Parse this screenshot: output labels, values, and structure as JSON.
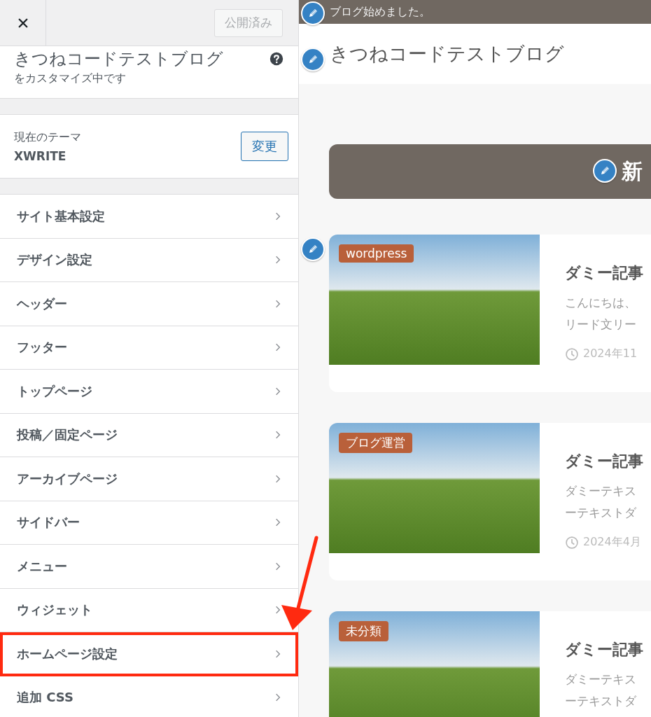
{
  "header": {
    "publish_button": {
      "label": "公開済み",
      "disabled": true
    }
  },
  "site_info": {
    "title": "きつねコードテストブログ",
    "subtitle": "をカスタマイズ中です"
  },
  "theme": {
    "label": "現在のテーマ",
    "name": "XWRITE",
    "change_button": "変更"
  },
  "menu": [
    {
      "label": "サイト基本設定",
      "highlighted": false
    },
    {
      "label": "デザイン設定",
      "highlighted": false
    },
    {
      "label": "ヘッダー",
      "highlighted": false
    },
    {
      "label": "フッター",
      "highlighted": false
    },
    {
      "label": "トップページ",
      "highlighted": false
    },
    {
      "label": "投稿／固定ページ",
      "highlighted": false
    },
    {
      "label": "アーカイブページ",
      "highlighted": false
    },
    {
      "label": "サイドバー",
      "highlighted": false
    },
    {
      "label": "メニュー",
      "highlighted": false
    },
    {
      "label": "ウィジェット",
      "highlighted": false
    },
    {
      "label": "ホームページ設定",
      "highlighted": true
    },
    {
      "label": "追加 CSS",
      "highlighted": false
    }
  ],
  "preview": {
    "top_bar": "ブログ始めました。",
    "site_title": "きつねコードテストブログ",
    "banner": "新",
    "posts": [
      {
        "category": "wordpress",
        "title": "ダミー記事",
        "excerpt": [
          "こんにちは、",
          "リード文リー"
        ],
        "date": "2024年11"
      },
      {
        "category": "ブログ運営",
        "title": "ダミー記事",
        "excerpt": [
          "ダミーテキス",
          "ーテキストダ"
        ],
        "date": "2024年4月"
      },
      {
        "category": "未分類",
        "title": "ダミー記事",
        "excerpt": [
          "ダミーテキス",
          "ーテキストダ"
        ]
      }
    ]
  }
}
